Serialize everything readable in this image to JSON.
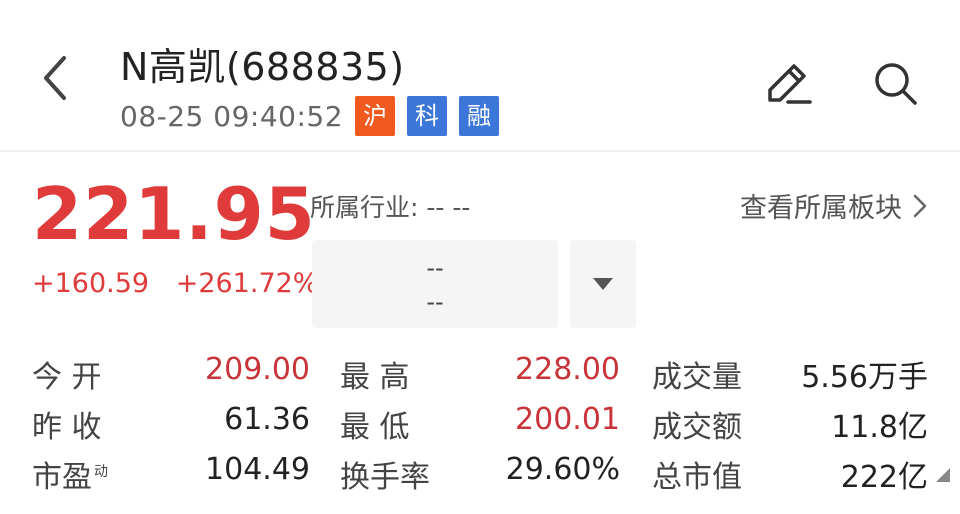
{
  "header": {
    "title": "N高凯(688835)",
    "time": "08-25 09:40:52",
    "badges": [
      {
        "label": "沪",
        "color": "#f05a1e"
      },
      {
        "label": "科",
        "color": "#3b76d8"
      },
      {
        "label": "融",
        "color": "#3b76d8"
      }
    ]
  },
  "quote": {
    "price": "221.95",
    "change": "+160.59",
    "change_pct": "+261.72%",
    "industry_label": "所属行业: -- --",
    "sector_link": "查看所属板块",
    "industry_box_line1": "--",
    "industry_box_line2": "--"
  },
  "stats": {
    "open_label": "今  开",
    "open_value": "209.00",
    "high_label": "最  高",
    "high_value": "228.00",
    "volume_label": "成交量",
    "volume_value": "5.56万手",
    "prev_close_label": "昨  收",
    "prev_close_value": "61.36",
    "low_label": "最  低",
    "low_value": "200.01",
    "turnover_label": "成交额",
    "turnover_value": "11.8亿",
    "pe_label": "市盈",
    "pe_sup": "动",
    "pe_value": "104.49",
    "turnover_rate_label": "换手率",
    "turnover_rate_value": "29.60%",
    "market_cap_label": "总市值",
    "market_cap_value": "222亿"
  },
  "colors": {
    "up": "#e03b3b",
    "price_red": "#c8343a"
  }
}
